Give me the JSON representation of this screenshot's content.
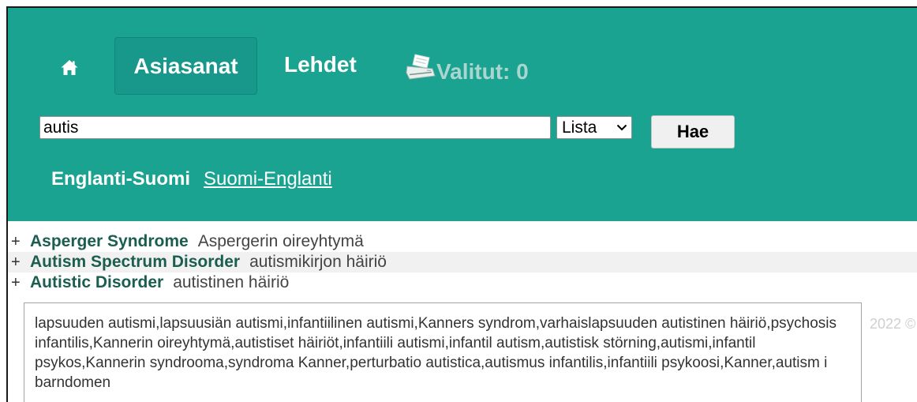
{
  "colors": {
    "header_bg": "#1aa391",
    "term": "#1b5e50",
    "selected_muted": "#aad6cf"
  },
  "nav": {
    "home": {
      "icon": "home-icon"
    },
    "tabs": [
      {
        "label": "Asiasanat",
        "active": true
      },
      {
        "label": "Lehdet",
        "active": false
      }
    ],
    "selected": {
      "icon": "printer-icon",
      "label": "Valitut: 0"
    }
  },
  "search": {
    "value": "autis",
    "mode": {
      "selected": "Lista",
      "icon": "chevron-down-icon"
    },
    "submit_label": "Hae"
  },
  "language": {
    "current": "Englanti-Suomi",
    "switch_link": "Suomi-Englanti"
  },
  "results": [
    {
      "toggle": "+",
      "term": "Asperger Syndrome",
      "translation": "Aspergerin oireyhtymä"
    },
    {
      "toggle": "+",
      "term": "Autism Spectrum Disorder",
      "translation": "autismikirjon häiriö"
    },
    {
      "toggle": "+",
      "term": "Autistic Disorder",
      "translation": "autistinen häiriö"
    }
  ],
  "synonyms": {
    "text": "lapsuuden autismi,lapsuusiän autismi,infantiilinen autismi,Kanners syndrom,varhaislapsuuden autistinen häiriö,psychosis infantilis,Kannerin oireyhtymä,autistiset häiriöt,infantiili autismi,infantil autism,autistisk störning,autismi,infantil psykos,Kannerin syndrooma,syndroma Kanner,perturbatio autistica,autismus infantilis,infantiili psykoosi,Kanner,autism i barndomen"
  },
  "footer": {
    "copyright": "2022 ©"
  }
}
